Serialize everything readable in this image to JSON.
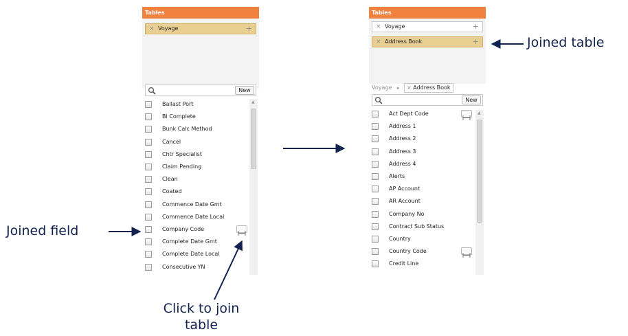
{
  "left_panel": {
    "header": "Tables",
    "tables": [
      {
        "label": "Voyage",
        "active": true
      }
    ],
    "search": {
      "placeholder": "",
      "new_label": "New"
    },
    "fields": [
      {
        "label": "Ballast Port",
        "joinable": false
      },
      {
        "label": "Bl Complete",
        "joinable": false
      },
      {
        "label": "Bunk Calc Method",
        "joinable": false
      },
      {
        "label": "Cancel",
        "joinable": false
      },
      {
        "label": "Chtr Specialist",
        "joinable": false
      },
      {
        "label": "Claim Pending",
        "joinable": false
      },
      {
        "label": "Clean",
        "joinable": false
      },
      {
        "label": "Coated",
        "joinable": false
      },
      {
        "label": "Commence Date Gmt",
        "joinable": false
      },
      {
        "label": "Commence Date Local",
        "joinable": false
      },
      {
        "label": "Company Code",
        "joinable": true
      },
      {
        "label": "Complete Date Gmt",
        "joinable": false
      },
      {
        "label": "Complete Date Local",
        "joinable": false
      },
      {
        "label": "Consecutive YN",
        "joinable": false
      }
    ]
  },
  "right_panel": {
    "header": "Tables",
    "tables": [
      {
        "label": "Voyage",
        "active": false
      },
      {
        "label": "Address Book",
        "active": true
      }
    ],
    "breadcrumb": {
      "root": "Voyage",
      "separator": "▸",
      "current": "Address Book"
    },
    "search": {
      "placeholder": "",
      "new_label": "New"
    },
    "fields": [
      {
        "label": "Act Dept Code",
        "joinable": true
      },
      {
        "label": "Address 1",
        "joinable": false
      },
      {
        "label": "Address 2",
        "joinable": false
      },
      {
        "label": "Address 3",
        "joinable": false
      },
      {
        "label": "Address 4",
        "joinable": false
      },
      {
        "label": "Alerts",
        "joinable": false
      },
      {
        "label": "AP Account",
        "joinable": false
      },
      {
        "label": "AR Account",
        "joinable": false
      },
      {
        "label": "Company No",
        "joinable": false
      },
      {
        "label": "Contract Sub Status",
        "joinable": false
      },
      {
        "label": "Country",
        "joinable": false
      },
      {
        "label": "Country Code",
        "joinable": true
      },
      {
        "label": "Credit Line",
        "joinable": false
      }
    ]
  },
  "annotations": {
    "joined_field": "Joined field",
    "click_to_join": [
      "Click to join",
      "table"
    ],
    "joined_table": "Joined table"
  },
  "colors": {
    "header": "#f0813f",
    "active_table": "#e9cf92",
    "annotation": "#12234f"
  },
  "icons": {
    "remove": "×",
    "add": "+",
    "join": "join-icon",
    "search": "search-icon"
  }
}
